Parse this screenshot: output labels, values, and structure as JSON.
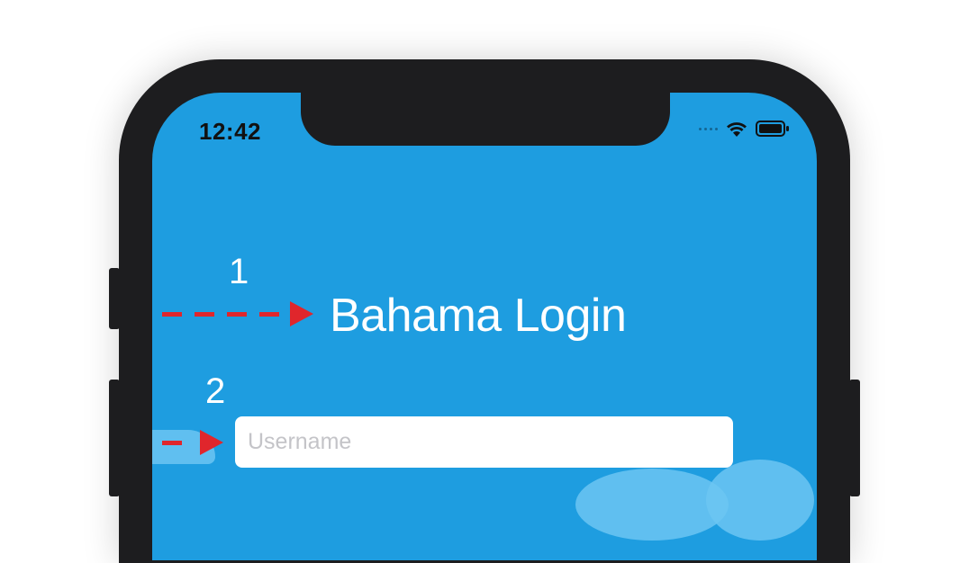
{
  "status_bar": {
    "time": "12:42"
  },
  "annotations": {
    "marker1": "1",
    "marker2": "2"
  },
  "login": {
    "title": "Bahama Login",
    "username_placeholder": "Username"
  },
  "colors": {
    "screen_background": "#1e9de0",
    "annotation_red": "#e0262c",
    "device_frame": "#1d1d1f"
  },
  "icons": [
    "wifi-icon",
    "battery-icon",
    "signal-dots-icon"
  ]
}
